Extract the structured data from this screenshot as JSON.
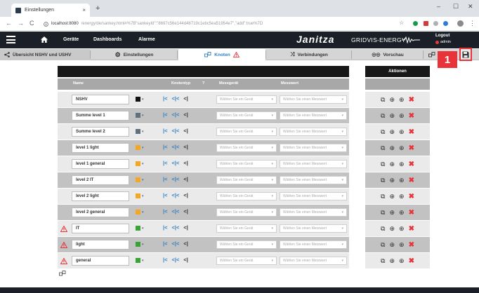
{
  "browser": {
    "tab_title": "Einstellungen",
    "tab_close": "×",
    "new_tab": "+",
    "url_host": "localhost:8080",
    "url_path": "/energy/de/sankey.html#%7B\"sankeyId\":\"8697c56e144d48719c1ebc5ea51954e7\",\"add\":true%7D",
    "nav_back": "←",
    "nav_forward": "→",
    "nav_reload": "C",
    "win_min": "–",
    "win_max": "☐",
    "win_close": "✕"
  },
  "appbar": {
    "menu": [
      "Geräte",
      "Dashboards",
      "Alarme"
    ],
    "brand": "Janitza",
    "product": "GRIDVIS-ENERGY",
    "logout": "Logout",
    "user": "admin"
  },
  "tabs": [
    {
      "label": "Übersicht NSHV und USHV",
      "icon": "share-icon"
    },
    {
      "label": "Einstellungen",
      "icon": "gears-icon"
    },
    {
      "label": "Knoten",
      "icon": "nodes-icon",
      "warning": true
    },
    {
      "label": "Verbindungen",
      "icon": "connections-icon"
    },
    {
      "label": "Vorschau",
      "icon": "preview-icon"
    }
  ],
  "callout_number": "1",
  "table": {
    "headers": {
      "name": "Name",
      "knotentyp": "Knotentyp",
      "messgeraet": "Messgerät",
      "messwert": "Messwert",
      "help": "?"
    },
    "actions_header": "Aktionen",
    "device_placeholder": "Wählen Sie ein Gerät",
    "value_placeholder": "Wählen Sie einen Messwert",
    "rows": [
      {
        "name": "NSHV",
        "color": "#111111",
        "warning": false
      },
      {
        "name": "Summe level 1",
        "color": "#607080",
        "warning": false
      },
      {
        "name": "Summe level 2",
        "color": "#607080",
        "warning": false
      },
      {
        "name": "level 1 light",
        "color": "#f5a623",
        "warning": false
      },
      {
        "name": "level 1 general",
        "color": "#f5a623",
        "warning": false
      },
      {
        "name": "level 2 IT",
        "color": "#f5a623",
        "warning": false
      },
      {
        "name": "level 2 light",
        "color": "#f5a623",
        "warning": false
      },
      {
        "name": "level 2 general",
        "color": "#f5a623",
        "warning": false
      },
      {
        "name": "IT",
        "color": "#3aa335",
        "warning": true
      },
      {
        "name": "light",
        "color": "#3aa335",
        "warning": true
      },
      {
        "name": "general",
        "color": "#3aa335",
        "warning": true
      }
    ]
  },
  "colors": {
    "accent_red": "#e8333a",
    "header_dark": "#1b1f27",
    "link_blue": "#2c7ec3"
  }
}
